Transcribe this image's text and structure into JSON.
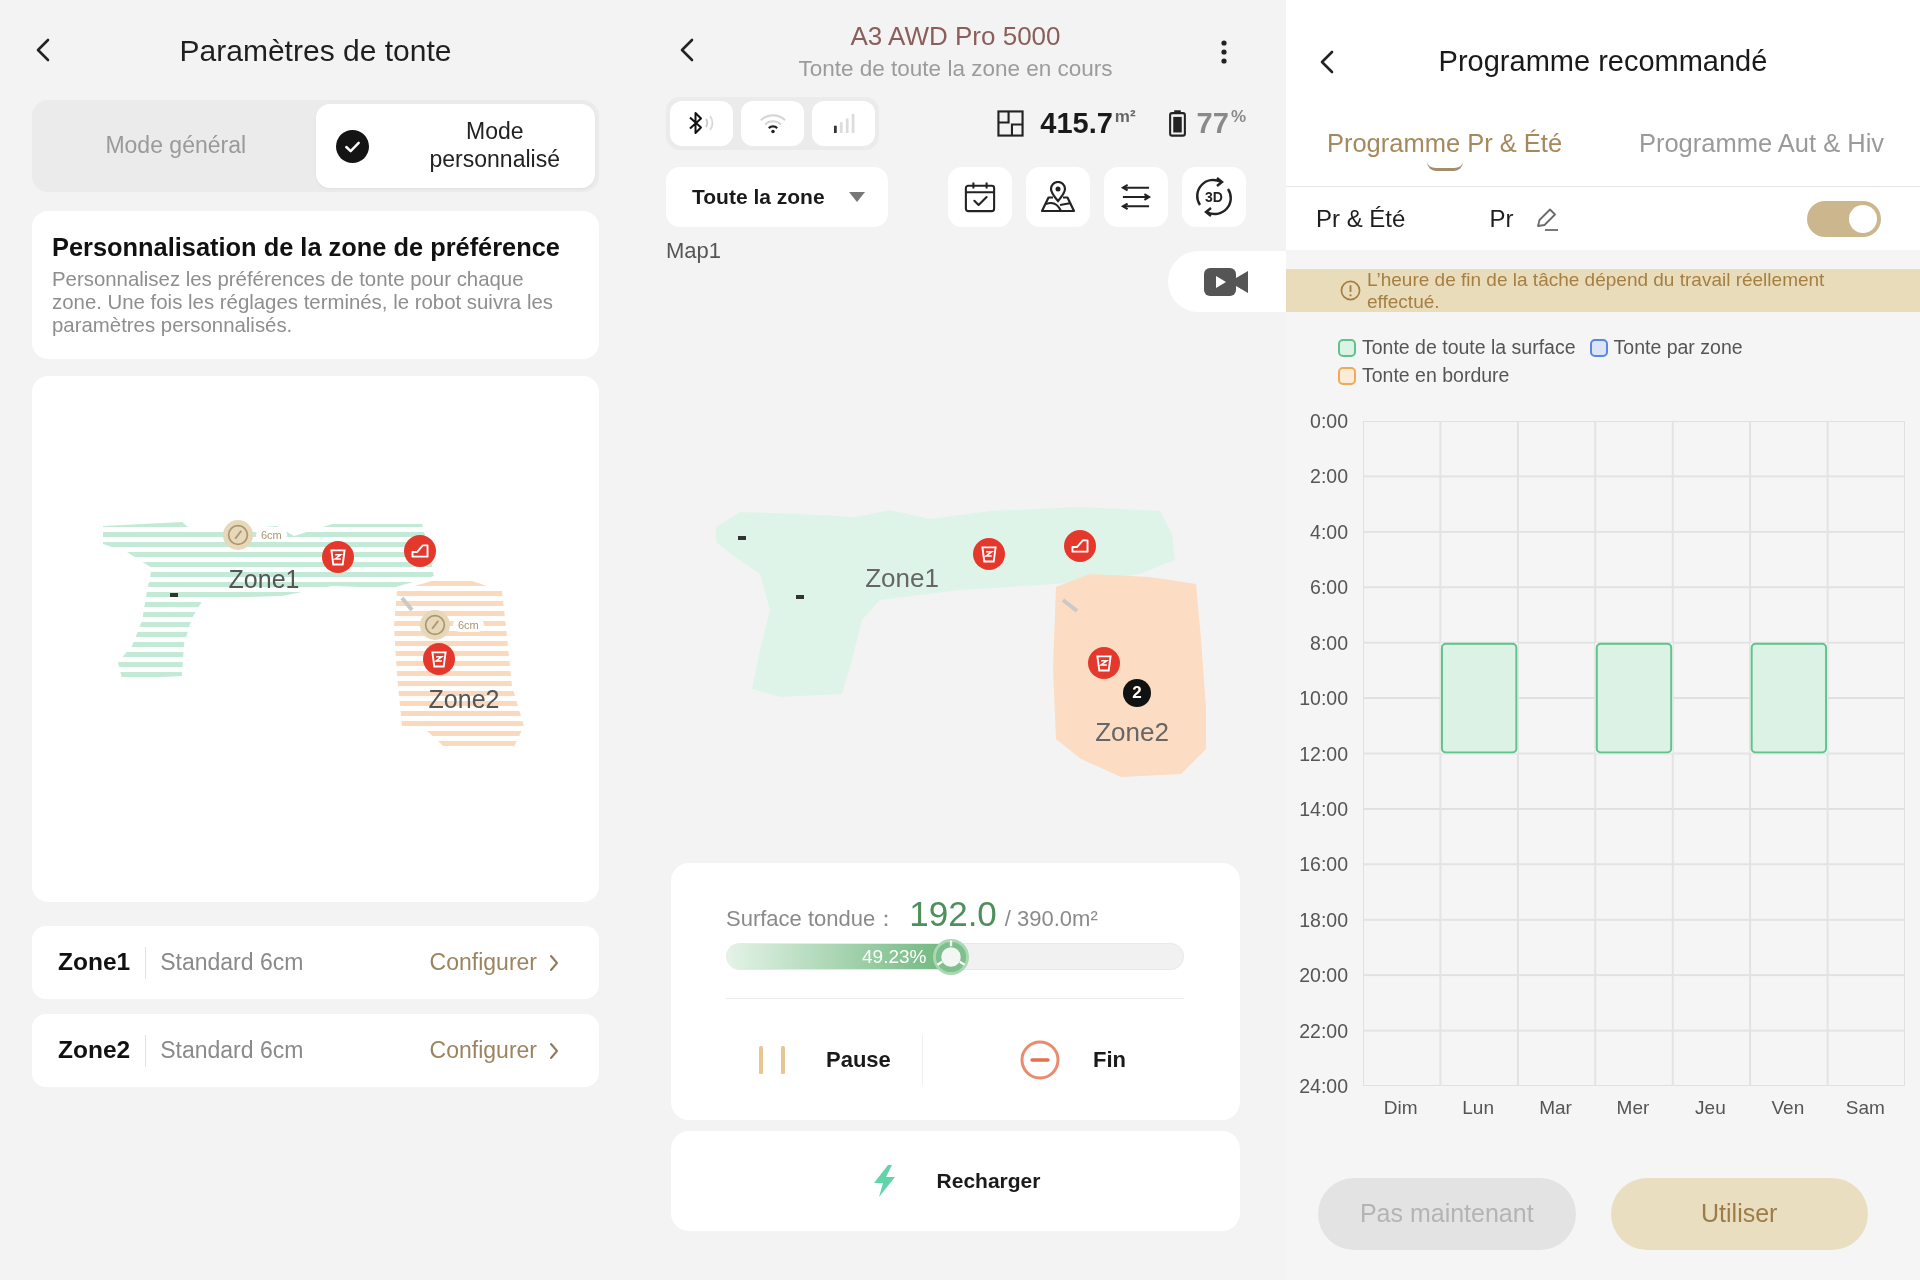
{
  "left": {
    "title": "Paramètres de tonte",
    "modes": [
      {
        "label": "Mode général",
        "selected": false
      },
      {
        "label": "Mode personnalisé",
        "selected": true
      }
    ],
    "info": {
      "title": "Personnalisation de la zone de préférence",
      "text": "Personnalisez les préférences de tonte pour chaque zone. Une fois les réglages terminés, le robot suivra les paramètres personnalisés."
    },
    "map": {
      "zones": [
        {
          "label": "Zone1",
          "height": "6cm",
          "color": "#c2ead6"
        },
        {
          "label": "Zone2",
          "height": "6cm",
          "color": "#fad9bd"
        }
      ]
    },
    "zones": [
      {
        "name": "Zone1",
        "setting": "Standard 6cm",
        "action": "Configurer"
      },
      {
        "name": "Zone2",
        "setting": "Standard 6cm",
        "action": "Configurer"
      }
    ]
  },
  "middle": {
    "title": "A3 AWD Pro 5000",
    "subtitle": "Tonte de toute la zone en cours",
    "area": {
      "value": "415.7",
      "unit": "m²"
    },
    "battery": {
      "value": "77",
      "unit": "%"
    },
    "zone_select": "Toute la zone",
    "view_3d": "3D",
    "map": {
      "name": "Map1",
      "zones": [
        {
          "label": "Zone1",
          "color": "#dff4e9"
        },
        {
          "label": "Zone2",
          "color": "#fcdcc2"
        }
      ],
      "robot_badge": "2"
    },
    "progress": {
      "label": "Surface tondue：",
      "done": "192.0",
      "total": "/ 390.0m²",
      "percent": "49.23%",
      "level": 0.4923
    },
    "actions": [
      {
        "kind": "pause",
        "label": "Pause"
      },
      {
        "kind": "stop",
        "label": "Fin"
      }
    ],
    "recharge": "Recharger"
  },
  "right": {
    "title": "Programme recommandé",
    "tabs": [
      {
        "label": "Programme Pr & Été",
        "selected": true
      },
      {
        "label": "Programme Aut & Hiv",
        "selected": false
      }
    ],
    "program": {
      "name_parts": [
        "Pr & Été",
        "Pr"
      ],
      "on": true
    },
    "notice": "L’heure de fin de la tâche dépend du travail réellement effectué.",
    "schedule": {
      "legend": [
        {
          "label": "Tonte de toute la surface",
          "color": "#5ec48b"
        },
        {
          "label": "Tonte par zone",
          "color": "#5b86e0"
        },
        {
          "label": "Tonte en bordure",
          "color": "#eeaa55"
        }
      ],
      "hours": [
        "0:00",
        "2:00",
        "4:00",
        "6:00",
        "8:00",
        "10:00",
        "12:00",
        "14:00",
        "16:00",
        "18:00",
        "20:00",
        "22:00",
        "24:00"
      ],
      "days": [
        {
          "label": "Dim",
          "slots": [
            {
              "filled": false
            },
            {
              "filled": false
            },
            {
              "filled": false
            },
            {
              "filled": false
            },
            {
              "filled": false
            },
            {
              "filled": false
            },
            {
              "filled": false
            },
            {
              "filled": false
            },
            {
              "filled": false
            },
            {
              "filled": false
            },
            {
              "filled": false
            },
            {
              "filled": false
            }
          ]
        },
        {
          "label": "Lun",
          "slots": [
            {
              "filled": false
            },
            {
              "filled": false
            },
            {
              "filled": false
            },
            {
              "filled": false
            },
            {
              "filled": true,
              "color": "#5ec48b"
            },
            {
              "filled": true,
              "color": "#5ec48b"
            },
            {
              "filled": false
            },
            {
              "filled": false
            },
            {
              "filled": false
            },
            {
              "filled": false
            },
            {
              "filled": false
            },
            {
              "filled": false
            }
          ]
        },
        {
          "label": "Mar",
          "slots": [
            {
              "filled": false
            },
            {
              "filled": false
            },
            {
              "filled": false
            },
            {
              "filled": false
            },
            {
              "filled": false
            },
            {
              "filled": false
            },
            {
              "filled": false
            },
            {
              "filled": false
            },
            {
              "filled": false
            },
            {
              "filled": false
            },
            {
              "filled": false
            },
            {
              "filled": false
            }
          ]
        },
        {
          "label": "Mer",
          "slots": [
            {
              "filled": false
            },
            {
              "filled": false
            },
            {
              "filled": false
            },
            {
              "filled": false
            },
            {
              "filled": true,
              "color": "#5ec48b"
            },
            {
              "filled": true,
              "color": "#5ec48b"
            },
            {
              "filled": false
            },
            {
              "filled": false
            },
            {
              "filled": false
            },
            {
              "filled": false
            },
            {
              "filled": false
            },
            {
              "filled": false
            }
          ]
        },
        {
          "label": "Jeu",
          "slots": [
            {
              "filled": false
            },
            {
              "filled": false
            },
            {
              "filled": false
            },
            {
              "filled": false
            },
            {
              "filled": false
            },
            {
              "filled": false
            },
            {
              "filled": false
            },
            {
              "filled": false
            },
            {
              "filled": false
            },
            {
              "filled": false
            },
            {
              "filled": false
            },
            {
              "filled": false
            }
          ]
        },
        {
          "label": "Ven",
          "slots": [
            {
              "filled": false
            },
            {
              "filled": false
            },
            {
              "filled": false
            },
            {
              "filled": false
            },
            {
              "filled": true,
              "color": "#5ec48b"
            },
            {
              "filled": true,
              "color": "#5ec48b"
            },
            {
              "filled": false
            },
            {
              "filled": false
            },
            {
              "filled": false
            },
            {
              "filled": false
            },
            {
              "filled": false
            },
            {
              "filled": false
            }
          ]
        },
        {
          "label": "Sam",
          "slots": [
            {
              "filled": false
            },
            {
              "filled": false
            },
            {
              "filled": false
            },
            {
              "filled": false
            },
            {
              "filled": false
            },
            {
              "filled": false
            },
            {
              "filled": false
            },
            {
              "filled": false
            },
            {
              "filled": false
            },
            {
              "filled": false
            },
            {
              "filled": false
            },
            {
              "filled": false
            }
          ]
        }
      ]
    },
    "buttons": [
      {
        "label": "Pas maintenant",
        "disabled": true
      },
      {
        "label": "Utiliser",
        "disabled": false
      }
    ]
  }
}
